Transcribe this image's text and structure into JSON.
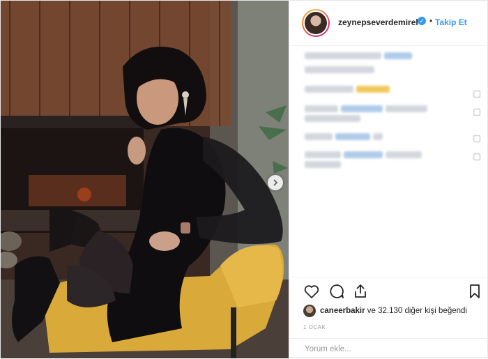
{
  "post": {
    "username": "zeynepseverdemirel",
    "follow_label": "Takip Et",
    "dot": "•",
    "verified_mark": "✓",
    "likes_user": "caneerbakir",
    "likes_rest": " ve 32.130 diğer kişi beğendi",
    "date": "1 OCAK",
    "comment_placeholder": "Yorum ekle..."
  },
  "icons": {
    "like": "heart-icon",
    "comment": "comment-bubble-icon",
    "share": "share-icon",
    "save": "bookmark-icon",
    "next": "chevron-right-icon"
  },
  "colors": {
    "link_blue": "#3897f0",
    "text": "#262626",
    "muted": "#999999"
  }
}
